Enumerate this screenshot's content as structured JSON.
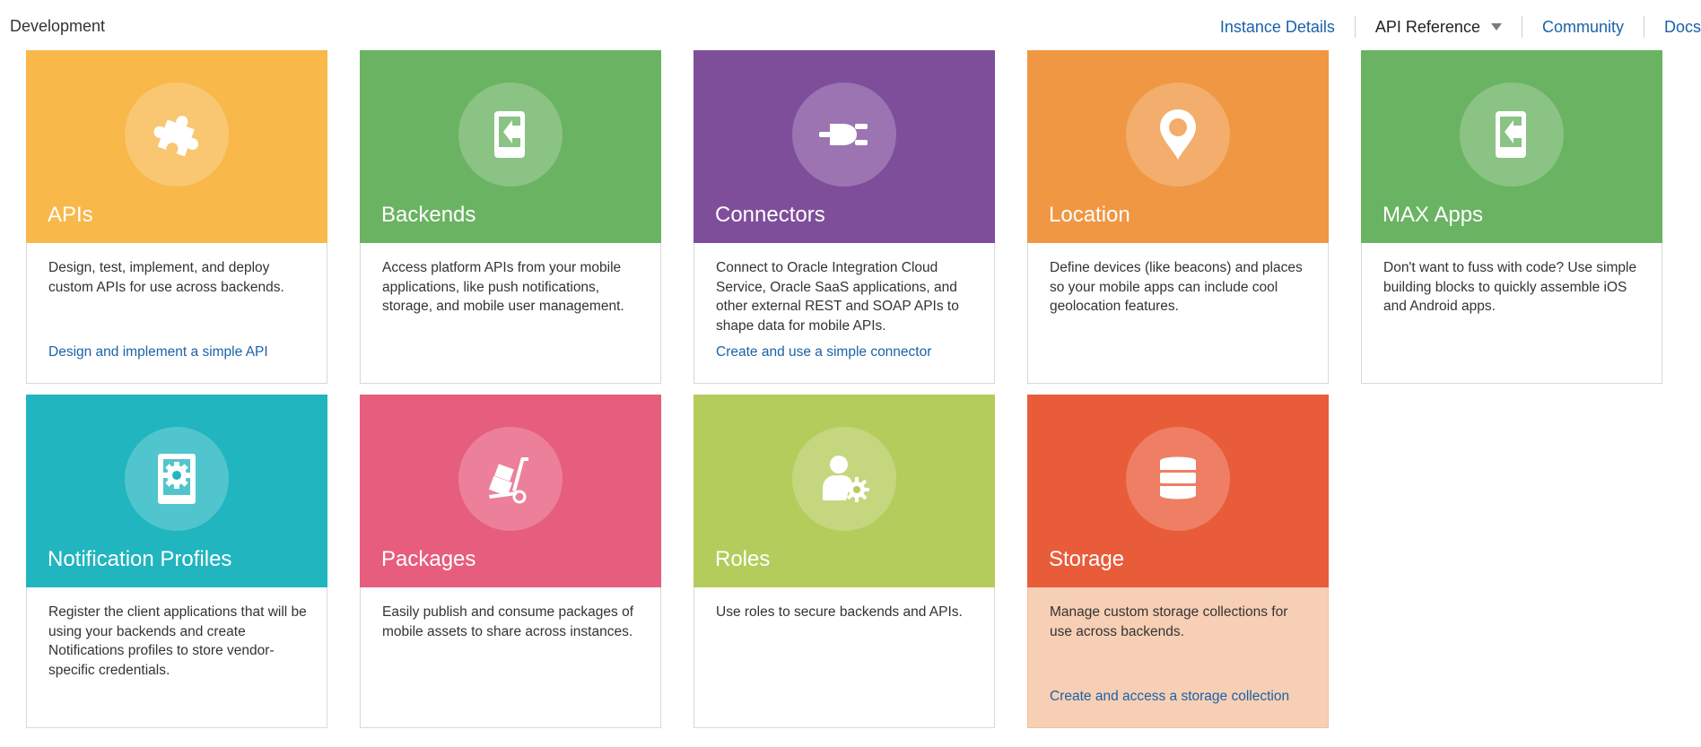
{
  "header": {
    "title": "Development",
    "nav": {
      "instance_details": "Instance Details",
      "api_reference": "API Reference",
      "community": "Community",
      "docs": "Docs"
    }
  },
  "colors": {
    "apis": "#f8b84a",
    "backends": "#6ab362",
    "connectors": "#7f4e9b",
    "location": "#f09743",
    "max_apps": "#6ab362",
    "notification_profiles": "#21b5bf",
    "packages": "#e75d7e",
    "roles": "#b4cc5b",
    "storage": "#e95c39",
    "link": "#1a62a8"
  },
  "cards": [
    {
      "title": "APIs",
      "icon": "puzzle-icon",
      "description": "Design, test, implement, and deploy custom APIs for use across backends.",
      "link": "Design and implement a simple API"
    },
    {
      "title": "Backends",
      "icon": "mobile-backend-icon",
      "description": "Access platform APIs from your mobile applications, like push notifications, storage, and mobile user management.",
      "link": ""
    },
    {
      "title": "Connectors",
      "icon": "plug-icon",
      "description": "Connect to Oracle Integration Cloud Service, Oracle SaaS applications, and other external REST and SOAP APIs to shape data for mobile APIs.",
      "link": "Create and use a simple connector"
    },
    {
      "title": "Location",
      "icon": "map-pin-icon",
      "description": "Define devices (like beacons) and places so your mobile apps can include cool geolocation features.",
      "link": ""
    },
    {
      "title": "MAX Apps",
      "icon": "mobile-app-icon",
      "description": "Don't want to fuss with code? Use simple building blocks to quickly assemble iOS and Android apps.",
      "link": ""
    },
    {
      "title": "Notification Profiles",
      "icon": "tablet-gear-icon",
      "description": "Register the client applications that will be using your backends and create Notifications profiles to store vendor-specific credentials.",
      "link": ""
    },
    {
      "title": "Packages",
      "icon": "hand-truck-icon",
      "description": "Easily publish and consume packages of mobile assets to share across instances.",
      "link": ""
    },
    {
      "title": "Roles",
      "icon": "user-gear-icon",
      "description": "Use roles to secure backends and APIs.",
      "link": ""
    },
    {
      "title": "Storage",
      "icon": "database-icon",
      "description": "Manage custom storage collections for use across backends.",
      "link": "Create and access a storage collection"
    }
  ]
}
